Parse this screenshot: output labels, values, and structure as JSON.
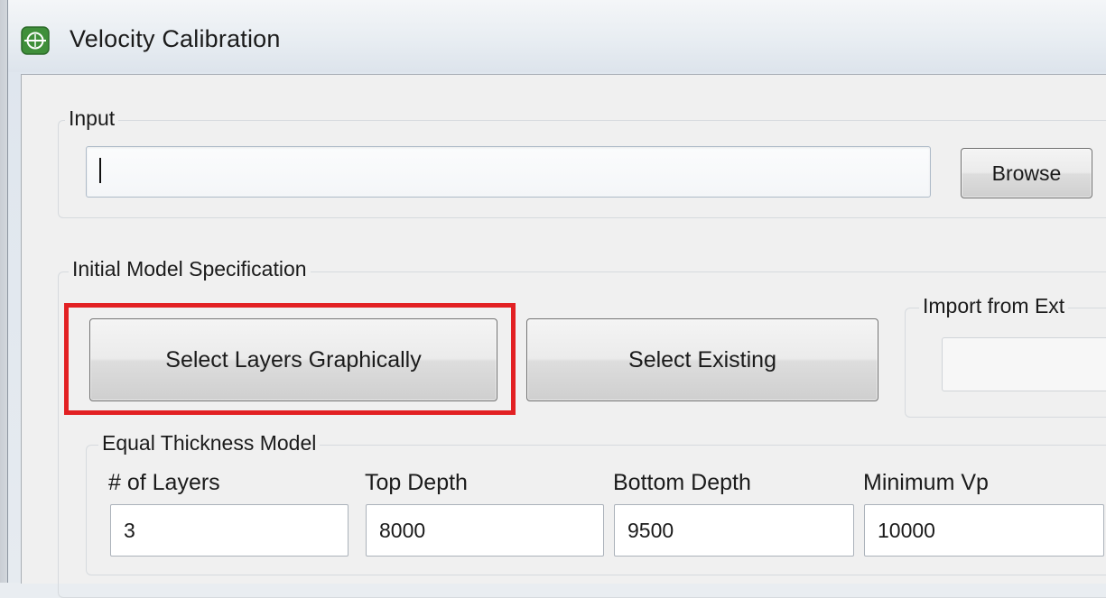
{
  "window": {
    "title": "Velocity Calibration",
    "icon": "app-logo-icon"
  },
  "input_group": {
    "label": "Input",
    "path_value": "",
    "browse_label": "Browse"
  },
  "spec_group": {
    "label": "Initial Model Specification",
    "select_layers_label": "Select Layers Graphically",
    "select_existing_label": "Select Existing",
    "import_label": "Import from Ext",
    "import_value": "",
    "highlight_color": "#e22023"
  },
  "thickness_group": {
    "label": "Equal Thickness Model",
    "fields": [
      {
        "label": "# of Layers",
        "value": "3"
      },
      {
        "label": "Top Depth",
        "value": "8000"
      },
      {
        "label": "Bottom Depth",
        "value": "9500"
      },
      {
        "label": "Minimum Vp",
        "value": "10000"
      }
    ]
  }
}
